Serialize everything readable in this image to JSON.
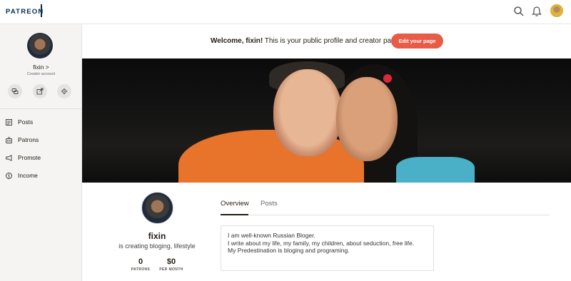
{
  "topbar": {
    "logo": "PATREON",
    "icons": [
      "search-icon",
      "bell-icon"
    ]
  },
  "sidebar": {
    "name": "fixin >",
    "subtitle": "Creator account",
    "quick_actions": [
      "chat-icon",
      "share-icon",
      "settings-icon"
    ],
    "nav": [
      {
        "label": "Posts",
        "icon": "posts-icon"
      },
      {
        "label": "Patrons",
        "icon": "patrons-icon"
      },
      {
        "label": "Promote",
        "icon": "megaphone-icon"
      },
      {
        "label": "Income",
        "icon": "dollar-icon"
      }
    ]
  },
  "banner": {
    "welcome_bold": "Welcome, fixin!",
    "welcome_rest": " This is your public profile and creator page.",
    "edit_button": "Edit your page"
  },
  "profile": {
    "name": "fixin",
    "description": "is creating bloging, lifestyle",
    "stats": [
      {
        "value": "0",
        "label": "PATRONS"
      },
      {
        "value": "$0",
        "label": "PER MONTH"
      }
    ]
  },
  "tabs": [
    {
      "label": "Overview",
      "active": true
    },
    {
      "label": "Posts",
      "active": false
    }
  ],
  "about": {
    "lines": [
      "I am well-known Russian Bloger.",
      "I write about my life, my family, my children, about seduction, free life.",
      "My Predestination is bloging and programing."
    ]
  },
  "colors": {
    "accent": "#e85b46",
    "brand": "#052d49",
    "sidebar_bg": "#f5f4f2"
  }
}
